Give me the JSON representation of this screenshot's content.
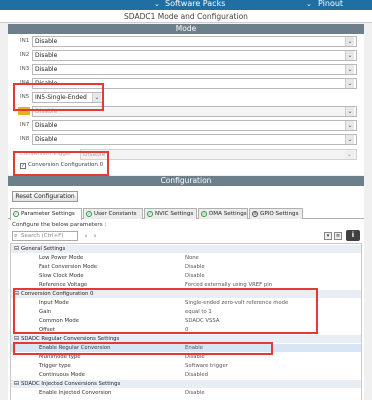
{
  "topbar": {
    "software_packs": "Software Packs",
    "pinout": "Pinout"
  },
  "title": "SDADC1 Mode and Configuration",
  "mode": {
    "header": "Mode",
    "inputs": [
      {
        "label": "IN1",
        "value": "Disable"
      },
      {
        "label": "IN2",
        "value": "Disable"
      },
      {
        "label": "IN3",
        "value": "Disable"
      },
      {
        "label": "IN4",
        "value": "Disable"
      },
      {
        "label": "IN5",
        "value": "IN5-Single-Ended"
      },
      {
        "label": "",
        "value": "Disable"
      },
      {
        "label": "IN7",
        "value": "Disable"
      },
      {
        "label": "IN8",
        "value": "Disable"
      }
    ],
    "conversion_trigger_label": "Conversion Trigger",
    "conversion_trigger_value": "Disable",
    "conversion_config_checkbox": "Conversion Configuration 0"
  },
  "configuration": {
    "header": "Configuration",
    "reset_button": "Reset Configuration",
    "tabs": [
      {
        "label": "Parameter Settings"
      },
      {
        "label": "User Constants"
      },
      {
        "label": "NVIC Settings"
      },
      {
        "label": "DMA Settings"
      },
      {
        "label": "GPIO Settings"
      }
    ],
    "below_params": "Configure the below parameters :",
    "search_placeholder": "Search (Ctrl+F)",
    "info_label": "i",
    "rows": [
      {
        "type": "section",
        "name": "General Settings"
      },
      {
        "type": "param",
        "name": "Low Power Mode",
        "value": "None"
      },
      {
        "type": "param",
        "name": "Fast Conversion Mode",
        "value": "Disable"
      },
      {
        "type": "param",
        "name": "Slow Clock Mode",
        "value": "Disable"
      },
      {
        "type": "param",
        "name": "Reference Voltage",
        "value": "Forced externally using VREF pin"
      },
      {
        "type": "section",
        "name": "Conversion Configuration 0"
      },
      {
        "type": "param",
        "name": "Input Mode",
        "value": "Single-ended zero-volt reference mode"
      },
      {
        "type": "param",
        "name": "Gain",
        "value": "equal to 1"
      },
      {
        "type": "param",
        "name": "Common Mode",
        "value": "SDADC VSSA"
      },
      {
        "type": "param",
        "name": "Offset",
        "value": "0"
      },
      {
        "type": "section",
        "name": "SDADC Regular Conversions Settings"
      },
      {
        "type": "param",
        "name": "Enable Regular Conversion",
        "value": "Enable",
        "highlight": true
      },
      {
        "type": "param",
        "name": "Multimode type",
        "value": "Disable"
      },
      {
        "type": "param",
        "name": "Trigger type",
        "value": "Software trigger"
      },
      {
        "type": "param",
        "name": "Continuous Mode",
        "value": "Disabled"
      },
      {
        "type": "section",
        "name": "SDADC Injected Conversions Settings"
      },
      {
        "type": "param",
        "name": "Enable Injected Conversion",
        "value": "Disable"
      }
    ]
  },
  "colors": {
    "accent_bar": "#6d7f8a",
    "topbar": "#1f6fa5",
    "annotation_red": "#e53935",
    "warning": "#e6b31e"
  }
}
